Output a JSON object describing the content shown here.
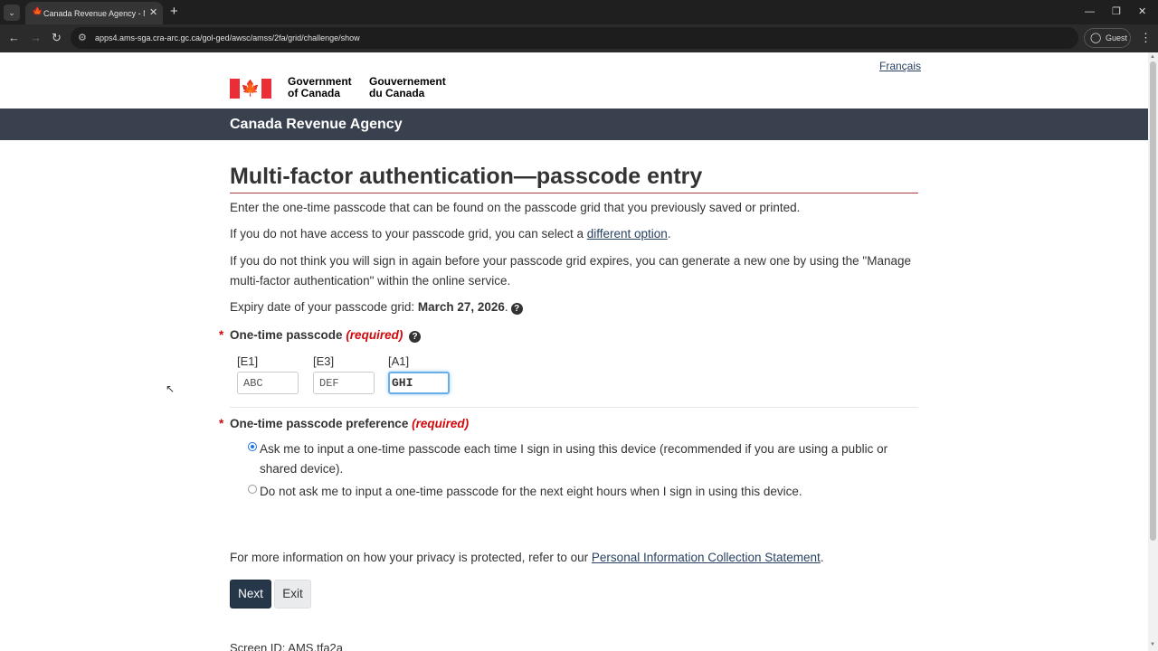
{
  "browser": {
    "tab_title": "Canada Revenue Agency - Multi-factor authentication",
    "tab_icon": "maple-leaf-icon",
    "url": "apps4.ams-sga.cra-arc.gc.ca/gol-ged/awsc/amss/2fa/grid/challenge/show",
    "profile_label": "Guest"
  },
  "header": {
    "language_link": "Français",
    "wordmark_en_line1": "Government",
    "wordmark_en_line2": "of Canada",
    "wordmark_fr_line1": "Gouvernement",
    "wordmark_fr_line2": "du Canada",
    "agency_name": "Canada Revenue Agency"
  },
  "main": {
    "title": "Multi-factor authentication—passcode entry",
    "intro": "Enter the one-time passcode that can be found on the passcode grid that you previously saved or printed.",
    "no_access_prefix": "If you do not have access to your passcode grid, you can select a ",
    "no_access_link": "different option",
    "no_access_suffix": ".",
    "expire_note": "If you do not think you will sign in again before your passcode grid expires, you can generate a new one by using the \"Manage multi-factor authentication\" within the online service.",
    "expiry_prefix": "Expiry date of your passcode grid: ",
    "expiry_date": "March 27, 2026",
    "expiry_suffix": "."
  },
  "passcode_field": {
    "required_marker": "*",
    "label": "One-time passcode",
    "required_text": "(required)",
    "cells": [
      {
        "label": "[E1]",
        "value": "ABC"
      },
      {
        "label": "[E3]",
        "value": "DEF"
      },
      {
        "label": "[A1]",
        "value": "GHI"
      }
    ]
  },
  "preference_field": {
    "required_marker": "*",
    "label": "One-time passcode preference",
    "required_text": "(required)",
    "options": [
      {
        "label": "Ask me to input a one-time passcode each time I sign in using this device (recommended if you are using a public or shared device).",
        "checked": true
      },
      {
        "label": "Do not ask me to input a one-time passcode for the next eight hours when I sign in using this device.",
        "checked": false
      }
    ]
  },
  "privacy": {
    "prefix": "For more information on how your privacy is protected, refer to our ",
    "link": "Personal Information Collection Statement",
    "suffix": "."
  },
  "buttons": {
    "next": "Next",
    "exit": "Exit"
  },
  "footer": {
    "screen_id": "Screen ID: AMS.tfa2a"
  },
  "colors": {
    "agency_bar": "#38414d",
    "required": "#d3080c",
    "link": "#284162",
    "primary_button": "#26374a"
  }
}
